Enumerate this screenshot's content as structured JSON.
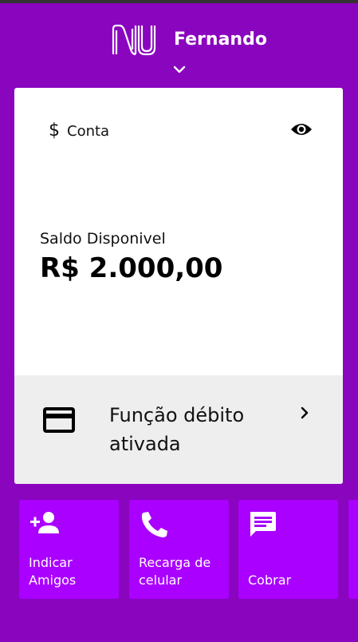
{
  "header": {
    "user_name": "Fernando",
    "logo_icon": "nubank-logo",
    "switch_icon": "chevron-down-icon"
  },
  "account_card": {
    "label": "Conta",
    "label_icon": "dollar-icon",
    "visibility_icon": "eye-icon",
    "balance_label": "Saldo Disponivel",
    "balance_value": "R$ 2.000,00",
    "debit_text": "Função débito ativada",
    "debit_icon": "credit-card-icon",
    "debit_arrow_icon": "chevron-right-icon"
  },
  "shortcuts": [
    {
      "label": "Indicar Amigos",
      "icon": "person-add-icon"
    },
    {
      "label": "Recarga de celular",
      "icon": "phone-icon"
    },
    {
      "label": "Cobrar",
      "icon": "message-icon"
    }
  ],
  "colors": {
    "brand_purple": "#8a05be",
    "tile_purple": "#aa00ff",
    "card_background": "#ffffff",
    "card_footer_background": "#eeeeee"
  }
}
